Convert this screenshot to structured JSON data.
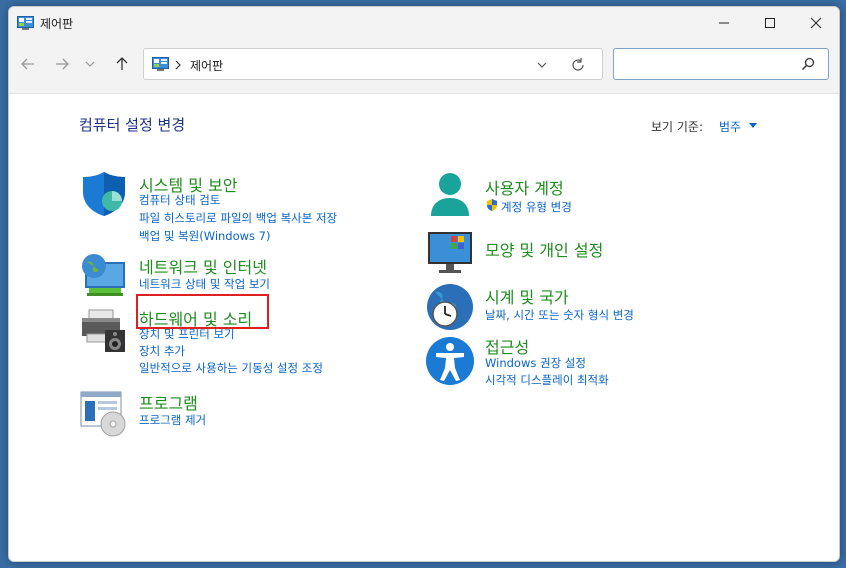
{
  "window": {
    "title": "제어판"
  },
  "address": {
    "crumb": "제어판",
    "search_placeholder": ""
  },
  "page": {
    "title": "컴퓨터 설정 변경",
    "view_by_label": "보기 기준:",
    "view_by_value": "범주"
  },
  "categories": {
    "system": {
      "title": "시스템 및 보안",
      "links": [
        "컴퓨터 상태 검토",
        "파일 히스토리로 파일의 백업 복사본 저장",
        "백업 및 복원(Windows 7)"
      ]
    },
    "network": {
      "title": "네트워크 및 인터넷",
      "links": [
        "네트워크 상태 및 작업 보기"
      ]
    },
    "hardware": {
      "title": "하드웨어 및 소리",
      "links": [
        "장치 및 프린터 보기",
        "장치 추가",
        "일반적으로 사용하는 기동성 설정 조정"
      ]
    },
    "programs": {
      "title": "프로그램",
      "links": [
        "프로그램 제거"
      ]
    },
    "users": {
      "title": "사용자 계정",
      "links": [
        "계정 유형 변경"
      ]
    },
    "appearance": {
      "title": "모양 및 개인 설정",
      "links": []
    },
    "clock": {
      "title": "시계 및 국가",
      "links": [
        "날짜, 시간 또는 숫자 형식 변경"
      ]
    },
    "access": {
      "title": "접근성",
      "links": [
        "Windows 권장 설정",
        "시각적 디스플레이 최적화"
      ]
    }
  },
  "colors": {
    "category_title": "#1e8c1e",
    "link": "#0a64c8",
    "page_title": "#1e3287",
    "highlight": "#e02020"
  }
}
